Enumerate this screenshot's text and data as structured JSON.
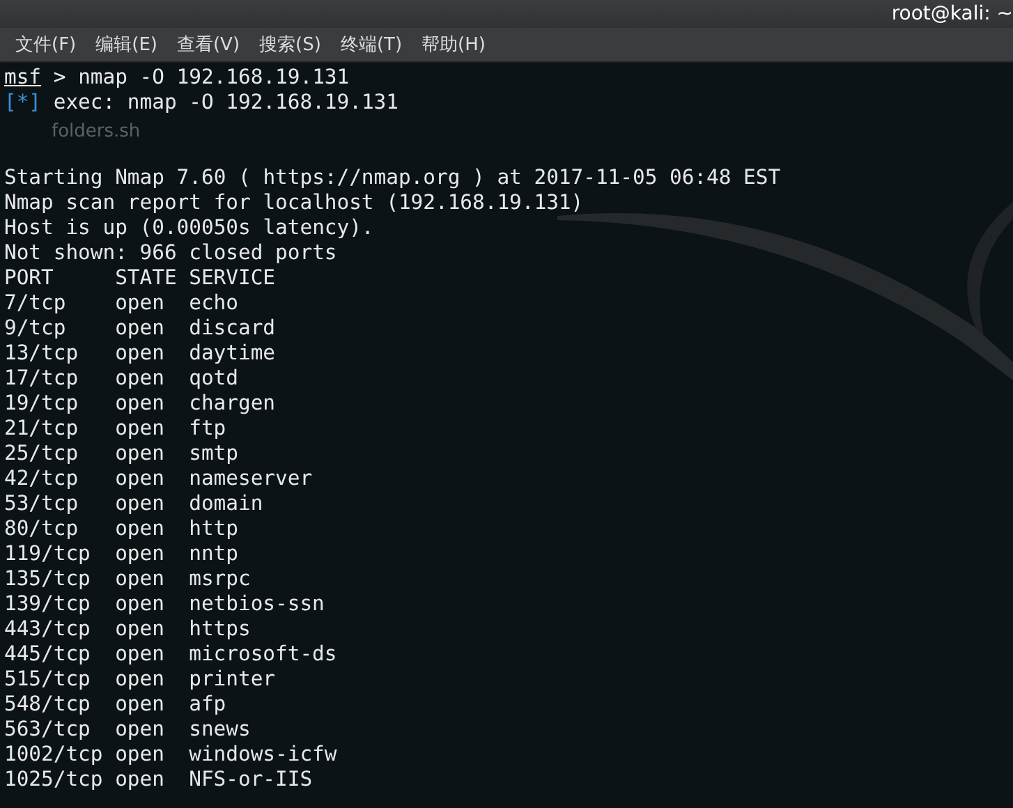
{
  "window": {
    "title": "root@kali: ~"
  },
  "menu": [
    "文件(F)",
    "编辑(E)",
    "查看(V)",
    "搜索(S)",
    "终端(T)",
    "帮助(H)"
  ],
  "desktop_label": "folders.sh",
  "prompt": {
    "name": "msf",
    "symbol": ">",
    "command": "nmap -O 192.168.19.131"
  },
  "exec": {
    "tag": "[*]",
    "text": "exec: nmap -O 192.168.19.131"
  },
  "output": [
    "Starting Nmap 7.60 ( https://nmap.org ) at 2017-11-05 06:48 EST",
    "Nmap scan report for localhost (192.168.19.131)",
    "Host is up (0.00050s latency).",
    "Not shown: 966 closed ports"
  ],
  "table": {
    "columns": [
      "PORT",
      "STATE",
      "SERVICE"
    ],
    "rows": [
      [
        "7/tcp",
        "open",
        "echo"
      ],
      [
        "9/tcp",
        "open",
        "discard"
      ],
      [
        "13/tcp",
        "open",
        "daytime"
      ],
      [
        "17/tcp",
        "open",
        "qotd"
      ],
      [
        "19/tcp",
        "open",
        "chargen"
      ],
      [
        "21/tcp",
        "open",
        "ftp"
      ],
      [
        "25/tcp",
        "open",
        "smtp"
      ],
      [
        "42/tcp",
        "open",
        "nameserver"
      ],
      [
        "53/tcp",
        "open",
        "domain"
      ],
      [
        "80/tcp",
        "open",
        "http"
      ],
      [
        "119/tcp",
        "open",
        "nntp"
      ],
      [
        "135/tcp",
        "open",
        "msrpc"
      ],
      [
        "139/tcp",
        "open",
        "netbios-ssn"
      ],
      [
        "443/tcp",
        "open",
        "https"
      ],
      [
        "445/tcp",
        "open",
        "microsoft-ds"
      ],
      [
        "515/tcp",
        "open",
        "printer"
      ],
      [
        "548/tcp",
        "open",
        "afp"
      ],
      [
        "563/tcp",
        "open",
        "snews"
      ],
      [
        "1002/tcp",
        "open",
        "windows-icfw"
      ],
      [
        "1025/tcp",
        "open",
        "NFS-or-IIS"
      ]
    ]
  }
}
